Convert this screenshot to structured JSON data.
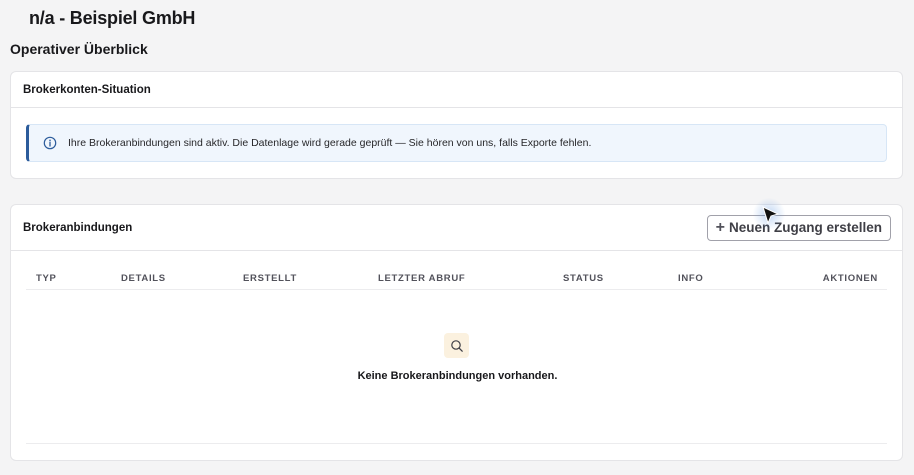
{
  "header": {
    "company": "n/a - Beispiel GmbH",
    "section": "Operativer Überblick"
  },
  "situation_card": {
    "title": "Brokerkonten-Situation",
    "alert_text": "Ihre Brokeranbindungen sind aktiv. Die Datenlage wird gerade geprüft — Sie hören von uns, falls Exporte fehlen.",
    "alert_icon": "info-circle-icon"
  },
  "connections_card": {
    "title": "Brokeranbindungen",
    "new_button_label": "Neuen Zugang erstellen",
    "new_button_icon": "plus-icon",
    "columns": [
      "TYP",
      "DETAILS",
      "ERSTELLT",
      "LETZTER ABRUF",
      "STATUS",
      "INFO",
      "AKTIONEN"
    ],
    "empty_icon": "search-icon",
    "empty_text": "Keine Brokeranbindungen vorhanden."
  },
  "colors": {
    "accent": "#2b5b9b",
    "alert_bg": "#f0f6fd",
    "empty_icon_bg": "#fbf1df"
  }
}
